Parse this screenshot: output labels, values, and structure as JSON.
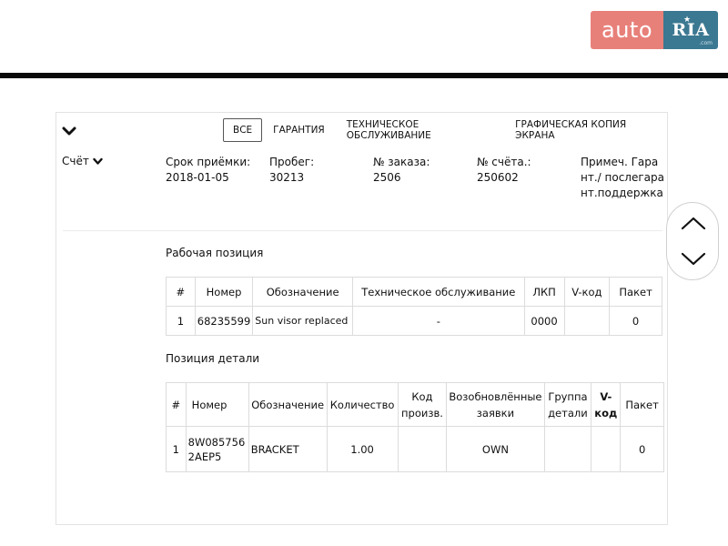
{
  "logo": {
    "auto": "auto",
    "ria": "RIA",
    "ria_sub": ".com"
  },
  "tabs": [
    {
      "label": "ВСЕ",
      "active": true
    },
    {
      "label": "ГАРАНТИЯ",
      "active": false
    },
    {
      "label": "ТЕХНИЧЕСКОЕ ОБСЛУЖИВАНИЕ",
      "active": false
    },
    {
      "label": "ГРАФИЧЕСКАЯ КОПИЯ ЭКРАНА",
      "active": false
    }
  ],
  "invoice": {
    "label": "Счёт",
    "fields": [
      {
        "label": "Срок приёмки:",
        "value": "2018-01-05"
      },
      {
        "label": "Пробег:",
        "value": "30213"
      },
      {
        "label": "№ заказа:",
        "value": "2506"
      },
      {
        "label": "№ счёта.:",
        "value": "250602"
      }
    ],
    "notes": "Примеч. Гарант./ послегарант.поддержка"
  },
  "work_position": {
    "title": "Рабочая позиция",
    "columns": [
      "#",
      "Номер",
      "Обозначение",
      "Техническое обслуживание",
      "ЛКП",
      "V-код",
      "Пакет"
    ],
    "rows": [
      [
        "1",
        "68235599",
        "Sun visor replaced",
        "-",
        "0000",
        "",
        "0"
      ]
    ]
  },
  "part_position": {
    "title": "Позиция детали",
    "columns": [
      "#",
      "Номер",
      "Обозначение",
      "Количество",
      "Код произв.",
      "Возобновлённые заявки",
      "Группа детали",
      "V-код",
      "Пакет"
    ],
    "rows": [
      [
        "1",
        "8W0857562AEP5",
        "BRACKET",
        "1.00",
        "",
        "OWN",
        "",
        "",
        "0"
      ]
    ]
  }
}
